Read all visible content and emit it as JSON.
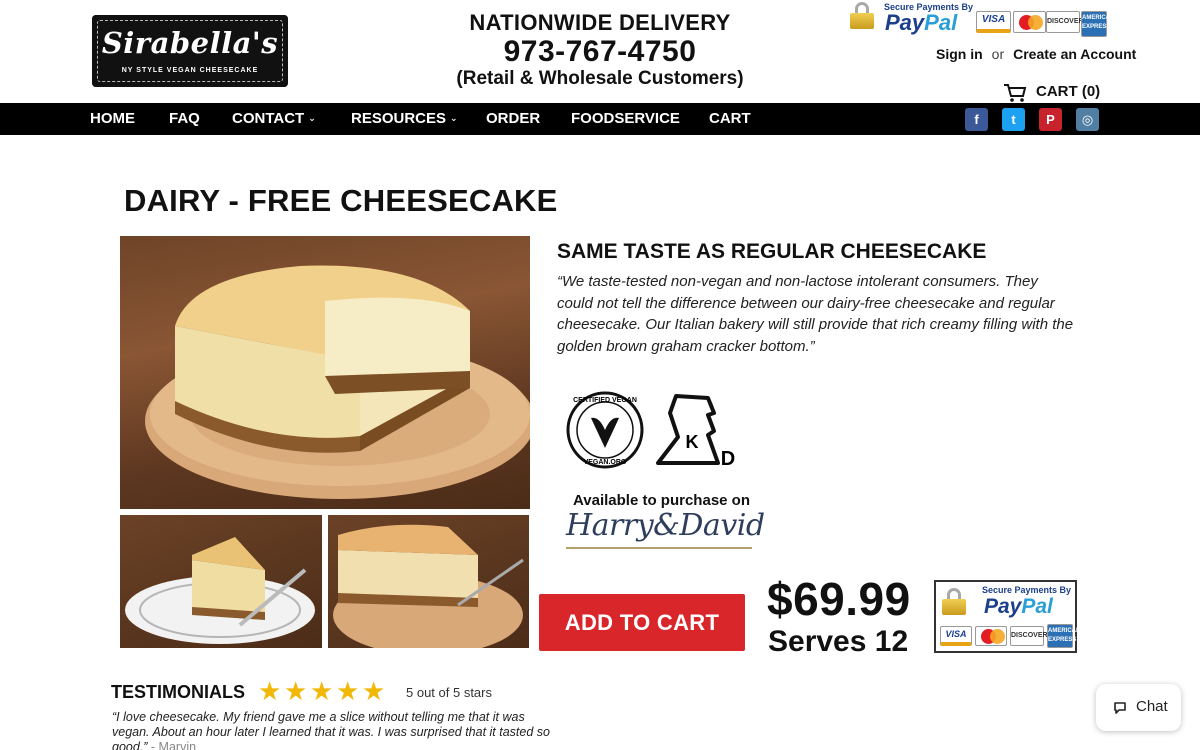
{
  "header": {
    "logo_name": "Sirabella's",
    "logo_tagline": "NY STYLE VEGAN CHEESECAKE",
    "delivery_title": "NATIONWIDE DELIVERY",
    "phone": "973-767-4750",
    "delivery_sub": "(Retail & Wholesale Customers)",
    "paypal_caption": "Secure Payments By",
    "paypal_word": "PayPal",
    "cards": [
      "VISA",
      "MasterCard",
      "DISCOVER",
      "AMERICAN EXPRESS"
    ],
    "sign_in": "Sign in",
    "or": "or",
    "create_account": "Create an Account",
    "cart_label": "CART (0)"
  },
  "nav": {
    "items": [
      "HOME",
      "FAQ",
      "CONTACT",
      "RESOURCES",
      "ORDER",
      "FOODSERVICE",
      "CART"
    ],
    "social": [
      {
        "name": "facebook-icon",
        "glyph": "f",
        "color": "#3b5998"
      },
      {
        "name": "twitter-icon",
        "glyph": "t",
        "color": "#1da1f2"
      },
      {
        "name": "pinterest-icon",
        "glyph": "P",
        "color": "#c8232c"
      },
      {
        "name": "instagram-icon",
        "glyph": "◎",
        "color": "#517fa4"
      }
    ]
  },
  "product": {
    "title": "DAIRY - FREE CHEESECAKE",
    "subheading": "SAME TASTE AS REGULAR CHEESECAKE",
    "quote": "“We taste-tested non-vegan and non-lactose intolerant consumers.  They could not tell the difference between our dairy-free cheesecake and regular cheesecake.  Our Italian bakery will still provide that rich creamy filling with the golden brown graham cracker bottom.”",
    "vegan_badge_top": "CERTIFIED VEGAN",
    "vegan_badge_bottom": "VEGAN.ORG",
    "kosher_letter": "K",
    "kosher_d": "D",
    "available_text": "Available to purchase on",
    "retailer": "Harry&David",
    "add_to_cart": "ADD TO CART",
    "price": "$69.99",
    "serves": "Serves 12"
  },
  "testimonials": {
    "heading": "TESTIMONIALS",
    "stars": 5,
    "rating_text": "5 out of 5 stars",
    "text": "“I love cheesecake. My friend gave me a slice without telling me that it was vegan. About an hour later I learned that it was. I was surprised that it tasted so good.”",
    "author": " - Marvin"
  },
  "chat": {
    "label": "Chat"
  },
  "colors": {
    "nav_bg": "#000000",
    "add_to_cart": "#d9262b",
    "star": "#f2b807"
  }
}
